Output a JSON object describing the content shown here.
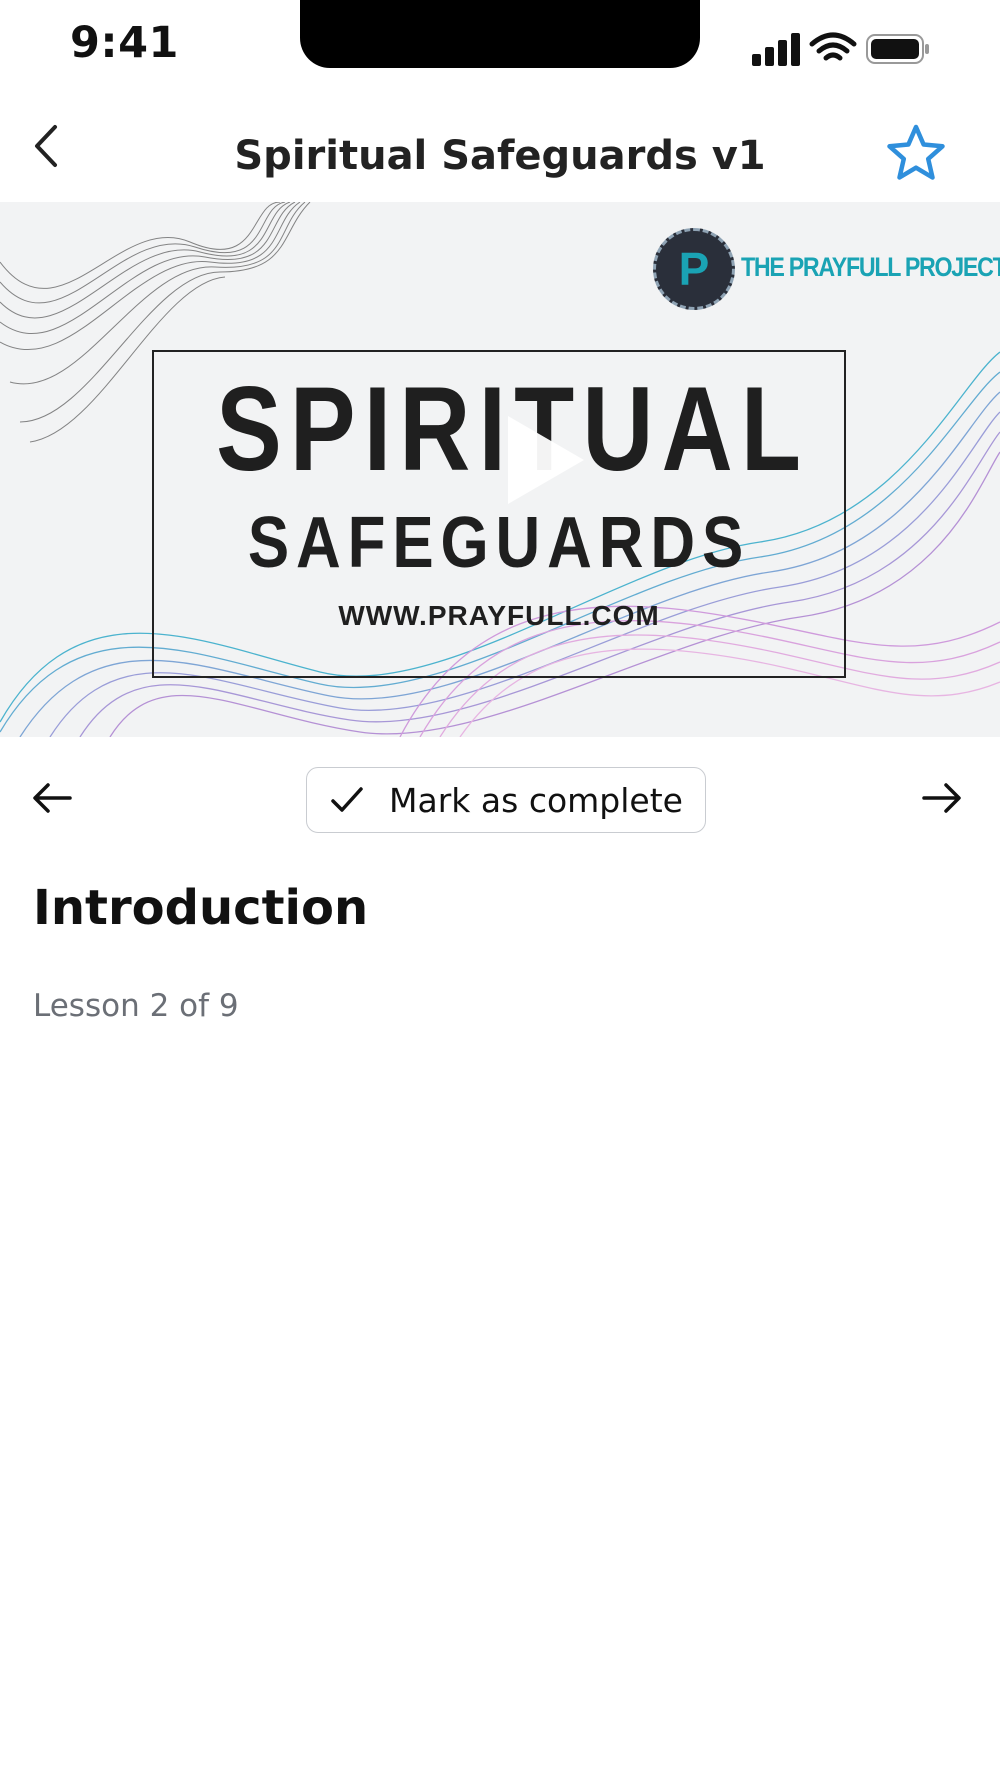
{
  "status_bar": {
    "time": "9:41",
    "icons": [
      "signal-icon",
      "wifi-icon",
      "battery-icon"
    ]
  },
  "nav": {
    "title": "Spiritual Safeguards v1",
    "back_icon": "chevron-left-icon",
    "favorite_icon": "star-icon"
  },
  "video": {
    "thumbnail": {
      "brand": "THE PRAYFULL PROJECT",
      "title": "SPIRITUAL",
      "subtitle": "SAFEGUARDS",
      "url": "WWW.PRAYFULL.COM"
    },
    "play_icon": "play-icon"
  },
  "controls": {
    "complete_label": "Mark as complete",
    "prev_icon": "arrow-left-icon",
    "next_icon": "arrow-right-icon"
  },
  "lesson": {
    "title": "Introduction",
    "progress": "Lesson 2 of 9"
  },
  "colors": {
    "accent": "#2f8fdc",
    "text": "#111111",
    "muted": "#6b6f76",
    "border": "#c9ccd1"
  }
}
